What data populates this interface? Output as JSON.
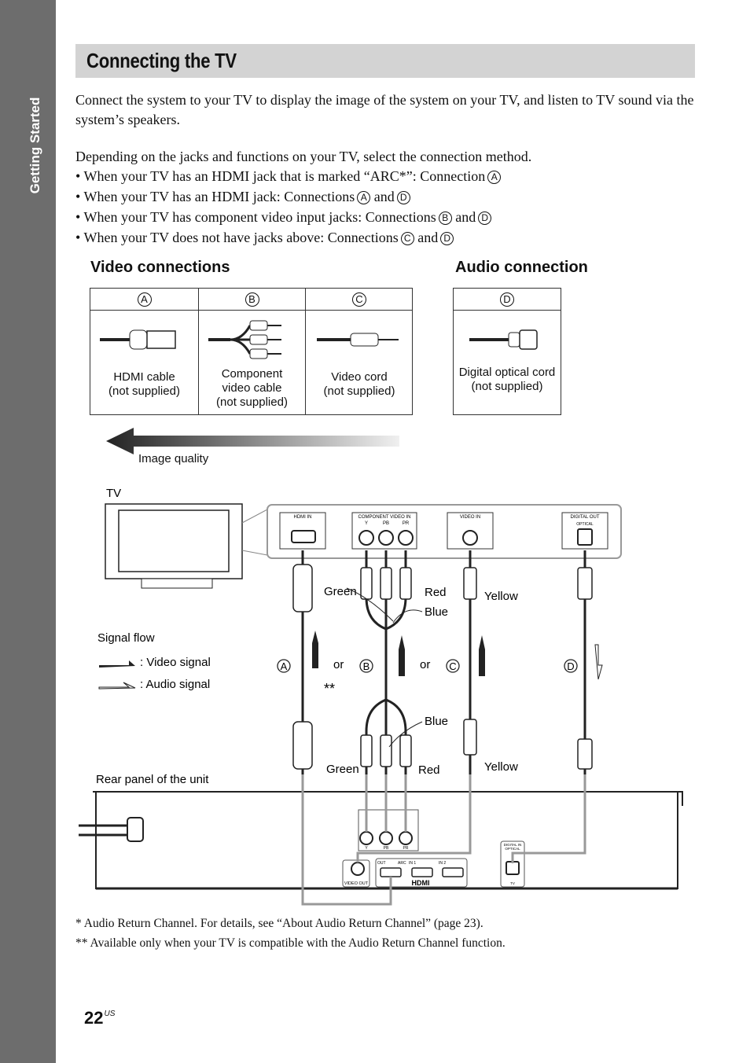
{
  "sidebar": {
    "section_label": "Getting Started"
  },
  "title": "Connecting the TV",
  "intro": "Connect the system to your TV to display the image of the system on your TV, and listen to TV sound via the system’s speakers.",
  "method_intro": "Depending on the jacks and functions on your TV, select the connection method.",
  "bullets": [
    {
      "text": "• When your TV has an HDMI jack that is marked “ARC*”: Connection",
      "refs": [
        "A"
      ]
    },
    {
      "text": "• When your TV has an HDMI jack: Connections",
      "refs": [
        "A",
        "D"
      ]
    },
    {
      "text": "• When your TV has component video input jacks: Connections",
      "refs": [
        "B",
        "D"
      ]
    },
    {
      "text": "• When your TV does not have jacks above: Connections",
      "refs": [
        "C",
        "D"
      ]
    }
  ],
  "and": "and",
  "video_connections": {
    "heading": "Video connections",
    "items": [
      {
        "ref": "A",
        "caption": [
          "HDMI cable",
          "(not supplied)"
        ]
      },
      {
        "ref": "B",
        "caption": [
          "Component",
          "video cable",
          "(not supplied)"
        ]
      },
      {
        "ref": "C",
        "caption": [
          "Video cord",
          "(not supplied)"
        ]
      }
    ]
  },
  "audio_connection": {
    "heading": "Audio connection",
    "items": [
      {
        "ref": "D",
        "caption": [
          "Digital optical cord",
          "(not supplied)"
        ]
      }
    ]
  },
  "image_quality": "Image quality",
  "diagram": {
    "tv_label": "TV",
    "tv_panel": {
      "hdmi_in": "HDMI IN",
      "component_video_in": "COMPONENT VIDEO IN",
      "y": "Y",
      "pb": "PB",
      "pr": "PR",
      "video_in": "VIDEO IN",
      "digital_out": "DIGITAL OUT",
      "optical": "OPTICAL"
    },
    "colors": {
      "green": "Green",
      "red": "Red",
      "blue": "Blue",
      "yellow": "Yellow"
    },
    "or": "or",
    "double_asterisk": "**",
    "signal_flow": {
      "title": "Signal flow",
      "video": ": Video signal",
      "audio": ": Audio signal"
    },
    "rear_panel_label": "Rear panel of the unit",
    "unit_panel": {
      "video_out": "VIDEO OUT",
      "out": "OUT",
      "arc": "ARC",
      "in1": "IN 1",
      "in2": "IN 2",
      "hdmi": "HDMI",
      "digital_in": "DIGITAL IN",
      "optical": "OPTICAL",
      "tv": "TV",
      "y": "Y",
      "pb": "PB",
      "pr": "PR"
    }
  },
  "footnotes": [
    "*   Audio Return Channel. For details, see “About Audio Return Channel” (page 23).",
    "** Available only when your TV is compatible with the Audio Return Channel function."
  ],
  "page_number": "22",
  "page_suffix": "US"
}
